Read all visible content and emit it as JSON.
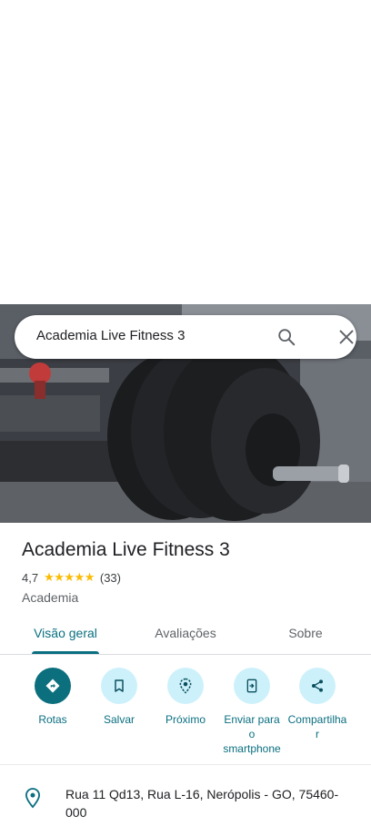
{
  "search": {
    "query": "Academia Live Fitness 3"
  },
  "place": {
    "name": "Academia Live Fitness 3",
    "rating": "4,7",
    "stars": "★★★★★",
    "reviews": "(33)",
    "category": "Academia"
  },
  "tabs": [
    {
      "label": "Visão geral"
    },
    {
      "label": "Avaliações"
    },
    {
      "label": "Sobre"
    }
  ],
  "actions": [
    {
      "label": "Rotas",
      "icon": "directions-icon"
    },
    {
      "label": "Salvar",
      "icon": "bookmark-icon"
    },
    {
      "label": "Próximo",
      "icon": "nearby-icon"
    },
    {
      "label_line1": "Enviar para",
      "label_line2": "o",
      "label_line3": "smartphone",
      "icon": "send-to-phone-icon"
    },
    {
      "label_line1": "Compartilha",
      "label_line2": "r",
      "icon": "share-icon"
    }
  ],
  "address": {
    "text": "Rua 11 Qd13, Rua L-16, Nerópolis - GO, 75460-000"
  },
  "colors": {
    "accent": "#0a6f80",
    "action_bg": "#cdf1fb",
    "star": "#fbbc04"
  }
}
